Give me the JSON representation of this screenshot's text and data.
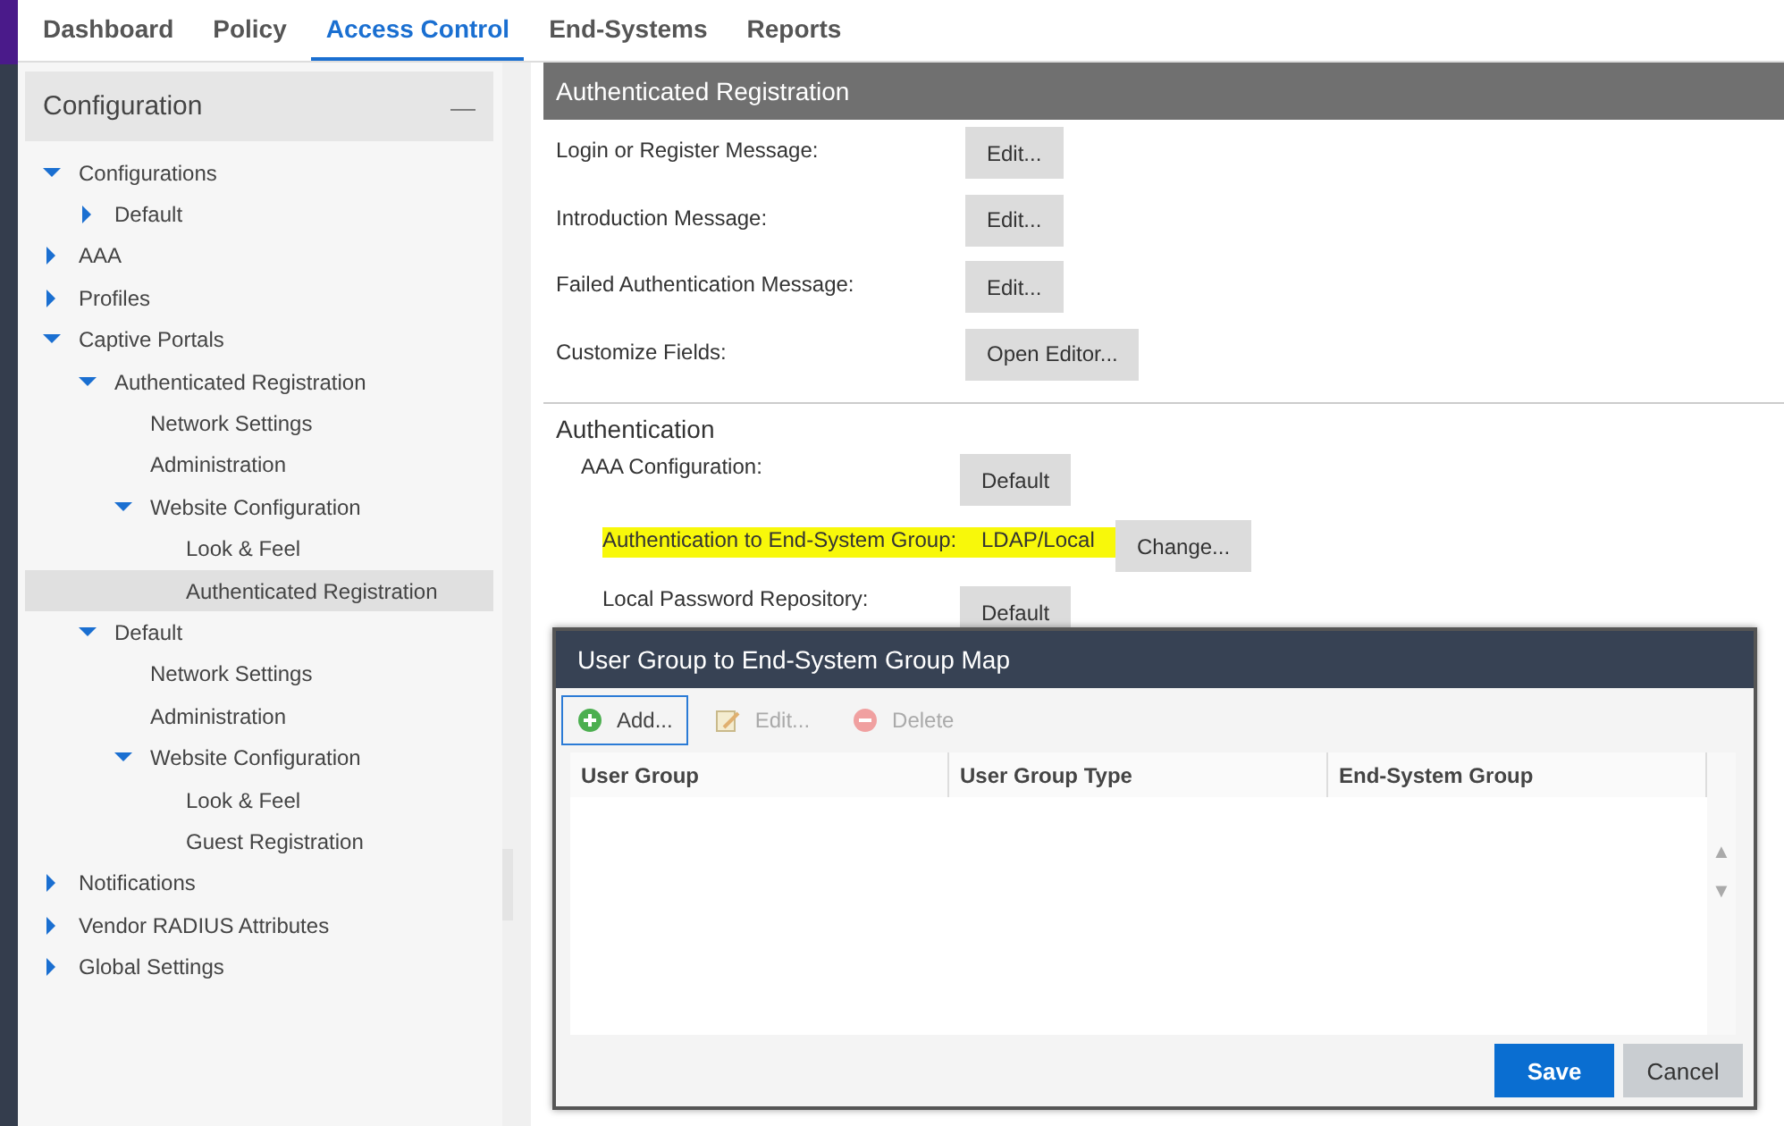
{
  "tabs": [
    {
      "label": "Dashboard",
      "selected": false
    },
    {
      "label": "Policy",
      "selected": false
    },
    {
      "label": "Access Control",
      "selected": true
    },
    {
      "label": "End-Systems",
      "selected": false
    },
    {
      "label": "Reports",
      "selected": false
    }
  ],
  "sidebar": {
    "title": "Configuration",
    "collapse_icon": "—",
    "tree": [
      {
        "label": "Configurations",
        "expanded": true,
        "selected": false,
        "children": [
          {
            "label": "Default",
            "expanded": false,
            "selected": false
          }
        ]
      },
      {
        "label": "AAA",
        "expanded": false,
        "selected": false
      },
      {
        "label": "Profiles",
        "expanded": false,
        "selected": false
      },
      {
        "label": "Captive Portals",
        "expanded": true,
        "selected": false,
        "children": [
          {
            "label": "Authenticated Registration",
            "expanded": true,
            "selected": false,
            "children": [
              {
                "label": "Network Settings",
                "selected": false
              },
              {
                "label": "Administration",
                "selected": false
              },
              {
                "label": "Website Configuration",
                "expanded": true,
                "selected": false,
                "children": [
                  {
                    "label": "Look & Feel",
                    "selected": false
                  },
                  {
                    "label": "Authenticated Registration",
                    "selected": true
                  }
                ]
              }
            ]
          },
          {
            "label": "Default",
            "expanded": true,
            "selected": false,
            "children": [
              {
                "label": "Network Settings",
                "selected": false
              },
              {
                "label": "Administration",
                "selected": false
              },
              {
                "label": "Website Configuration",
                "expanded": true,
                "selected": false,
                "children": [
                  {
                    "label": "Look & Feel",
                    "selected": false
                  },
                  {
                    "label": "Guest Registration",
                    "selected": false
                  }
                ]
              }
            ]
          }
        ]
      },
      {
        "label": "Notifications",
        "expanded": false,
        "selected": false
      },
      {
        "label": "Vendor RADIUS Attributes",
        "expanded": false,
        "selected": false
      },
      {
        "label": "Global Settings",
        "expanded": false,
        "selected": false
      }
    ]
  },
  "panel": {
    "title": "Authenticated Registration",
    "messages": [
      {
        "label": "Login or Register Message:",
        "button": "Edit..."
      },
      {
        "label": "Introduction Message:",
        "button": "Edit..."
      },
      {
        "label": "Failed Authentication Message:",
        "button": "Edit..."
      },
      {
        "label": "Customize Fields:",
        "button": "Open Editor..."
      }
    ],
    "authentication": {
      "heading": "Authentication",
      "rows": [
        {
          "kind": "button",
          "label": "AAA Configuration:",
          "button": "Default"
        },
        {
          "kind": "value",
          "label": "Authentication to End-System Group:",
          "value": "LDAP/Local",
          "button": "Change...",
          "highlighted": true
        },
        {
          "kind": "button",
          "label": "Local Password Repository:",
          "button": "Default"
        }
      ]
    }
  },
  "dialog": {
    "title": "User Group to End-System Group Map",
    "toolbar": [
      {
        "label": "Add...",
        "kind": "add",
        "disabled": false
      },
      {
        "label": "Edit...",
        "kind": "edit",
        "disabled": true
      },
      {
        "label": "Delete",
        "kind": "delete",
        "disabled": true
      }
    ],
    "columns": [
      "User Group",
      "User Group Type",
      "End-System Group"
    ],
    "scroll_up": "▲",
    "scroll_down": "▼",
    "buttons": [
      {
        "label": "Save",
        "kind": "primary"
      },
      {
        "label": "Cancel",
        "kind": "secondary"
      }
    ]
  }
}
